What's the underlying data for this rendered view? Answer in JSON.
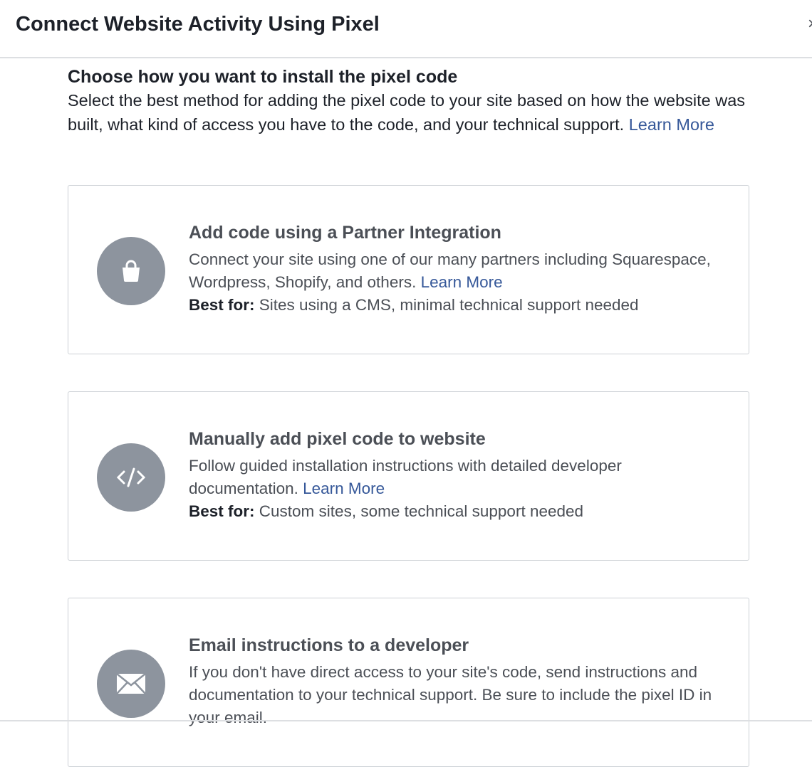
{
  "header": {
    "title": "Connect Website Activity Using Pixel",
    "close": "×"
  },
  "intro": {
    "heading": "Choose how you want to install the pixel code",
    "text": "Select the best method for adding the pixel code to your site based on how the website was built, what kind of access you have to the code, and your technical support.",
    "link": "Learn More"
  },
  "options": [
    {
      "title": "Add code using a Partner Integration",
      "desc": "Connect your site using one of our many partners including Squarespace, Wordpress, Shopify, and others.",
      "link": "Learn More",
      "best_label": "Best for:",
      "best": "Sites using a CMS, minimal technical support needed"
    },
    {
      "title": "Manually add pixel code to website",
      "desc": "Follow guided installation instructions with detailed developer documentation.",
      "link": "Learn More",
      "best_label": "Best for:",
      "best": "Custom sites, some technical support needed"
    },
    {
      "title": "Email instructions to a developer",
      "desc": "If you don't have direct access to your site's code, send instructions and documentation to your technical support. Be sure to include the pixel ID in your email."
    }
  ]
}
